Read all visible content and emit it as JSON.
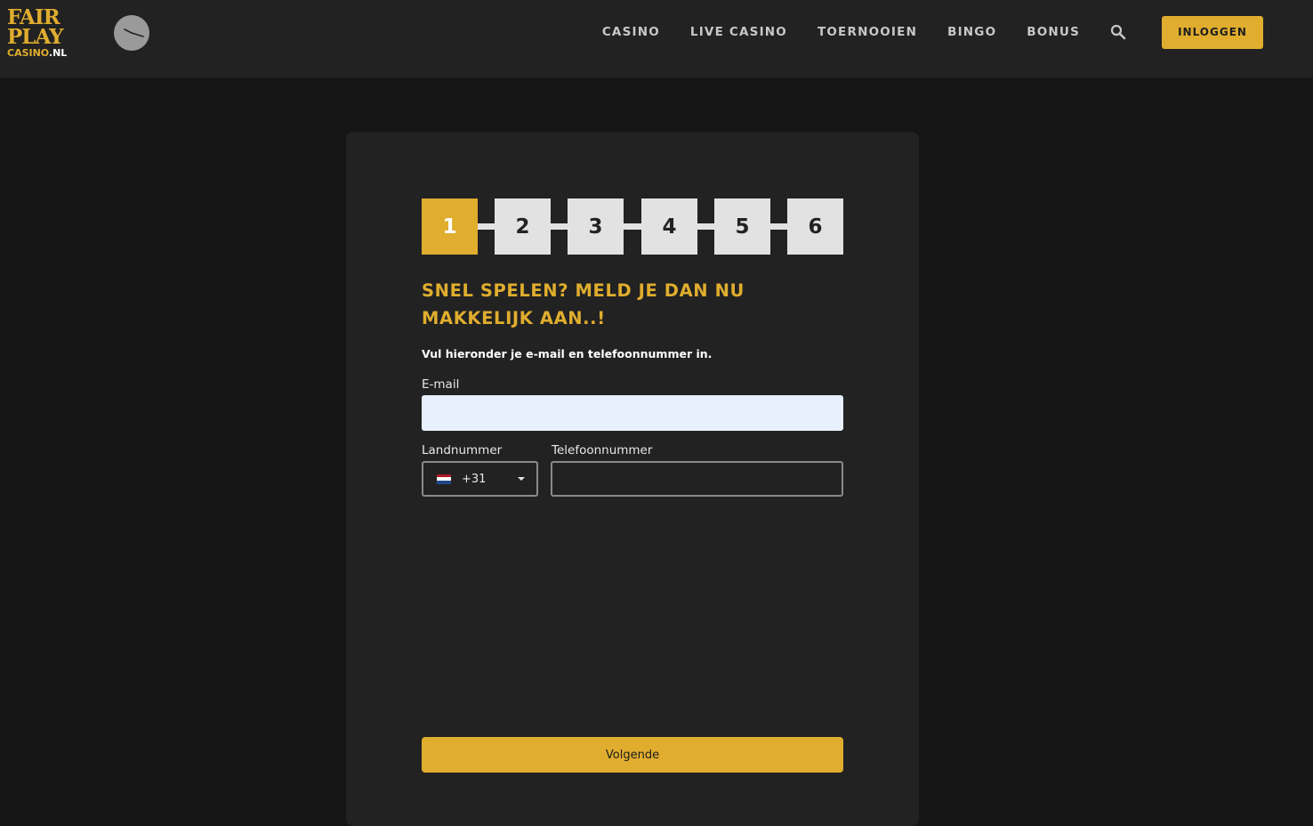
{
  "brand": {
    "logo_line1": "FAIR",
    "logo_line2": "PLAY",
    "logo_line3_prefix": "CASINO",
    "logo_line3_suffix": ".NL",
    "accent_color": "#e0ad2e"
  },
  "nav": {
    "items": [
      {
        "label": "CASINO"
      },
      {
        "label": "LIVE CASINO"
      },
      {
        "label": "TOERNOOIEN"
      },
      {
        "label": "BINGO"
      },
      {
        "label": "BONUS"
      }
    ],
    "search_icon": "search-icon",
    "login_label": "INLOGGEN"
  },
  "steps": {
    "items": [
      "1",
      "2",
      "3",
      "4",
      "5",
      "6"
    ],
    "active": 1
  },
  "form": {
    "title_line1": "SNEL SPELEN? MELD JE DAN NU",
    "title_line2": "MAKKELIJK AAN..!",
    "subtitle": "Vul hieronder je e-mail en telefoonnummer in.",
    "email_label": "E-mail",
    "email_value": "",
    "country_label": "Landnummer",
    "country_code": "+31",
    "country_flag_icon": "netherlands-flag-icon",
    "phone_label": "Telefoonnummer",
    "phone_value": "",
    "next_label": "Volgende"
  }
}
